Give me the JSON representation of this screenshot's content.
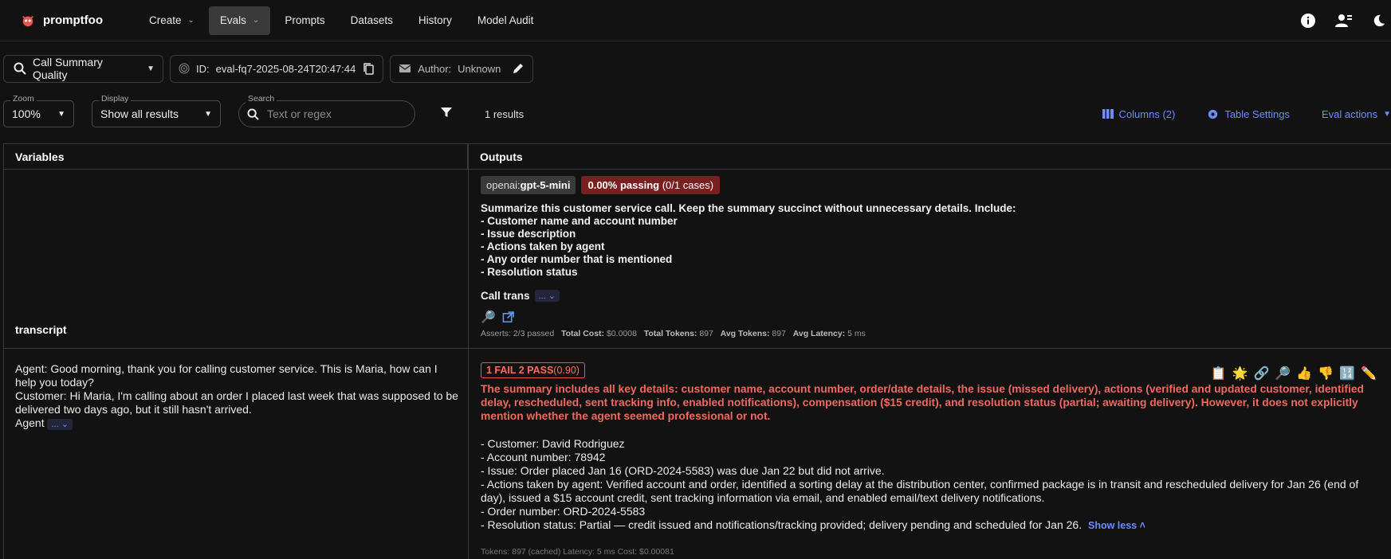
{
  "app": {
    "name": "promptfoo"
  },
  "nav": [
    {
      "label": "Create",
      "chevron": true,
      "active": false
    },
    {
      "label": "Evals",
      "chevron": true,
      "active": true
    },
    {
      "label": "Prompts",
      "chevron": false,
      "active": false
    },
    {
      "label": "Datasets",
      "chevron": false,
      "active": false
    },
    {
      "label": "History",
      "chevron": false,
      "active": false
    },
    {
      "label": "Model Audit",
      "chevron": false,
      "active": false
    }
  ],
  "eval_selector": {
    "value": "Call Summary Quality"
  },
  "eval_id": {
    "label": "ID:",
    "value": "eval-fq7-2025-08-24T20:47:44"
  },
  "author": {
    "label": "Author:",
    "value": "Unknown"
  },
  "controls": {
    "zoom_label": "Zoom",
    "zoom_value": "100%",
    "display_label": "Display",
    "display_value": "Show all results",
    "search_label": "Search",
    "search_placeholder": "Text or regex",
    "results": "1 results",
    "columns": "Columns (2)",
    "table_settings": "Table Settings",
    "eval_actions": "Eval actions"
  },
  "table": {
    "col_variables": "Variables",
    "col_outputs": "Outputs",
    "var_name": "transcript",
    "provider_prefix": "openai:",
    "provider_model": "gpt-5-mini",
    "pass_rate": "0.00% passing",
    "pass_cases": "(0/1 cases)",
    "prompt_text": "Summarize this customer service call. Keep the summary succinct without unnecessary details. Include:\n- Customer name and account number\n- Issue description\n- Actions taken by agent\n- Any order number that is mentioned\n- Resolution status",
    "call_trans": "Call trans",
    "more": "...",
    "stats": {
      "asserts": "Asserts: 2/3 passed",
      "cost_label": "Total Cost:",
      "cost": "$0.0008",
      "tokens_label": "Total Tokens:",
      "tokens": "897",
      "avg_tokens_label": "Avg Tokens:",
      "avg_tokens": "897",
      "avg_latency_label": "Avg Latency:",
      "avg_latency": "5 ms"
    },
    "transcript_text": "Agent: Good morning, thank you for calling customer service. This is Maria, how can I help you today?\nCustomer: Hi Maria, I'm calling about an order I placed last week that was supposed to be delivered two days ago, but it still hasn't arrived.\nAgent",
    "result_badge": "1 FAIL 2 PASS",
    "result_score": "(0.90)",
    "fail_reason": "The summary includes all key details: customer name, account number, order/date details, the issue (missed delivery), actions (verified and updated customer, identified delay, rescheduled, sent tracking info, enabled notifications), compensation ($15 credit), and resolution status (partial; awaiting delivery). However, it does not explicitly mention whether the agent seemed professional or not.",
    "answer": "- Customer: David Rodriguez\n- Account number: 78942\n- Issue: Order placed Jan 16 (ORD-2024-5583) was due Jan 22 but did not arrive.\n- Actions taken by agent: Verified account and order, identified a sorting delay at the distribution center, confirmed package is in transit and rescheduled delivery for Jan 26 (end of day), issued a $15 account credit, sent tracking information via email, and enabled email/text delivery notifications.\n- Order number: ORD-2024-5583\n- Resolution status: Partial — credit issued and notifications/tracking provided; delivery pending and scheduled for Jan 26.",
    "show_less": "Show less",
    "footer_faded": "Tokens: 897 (cached)   Latency: 5 ms   Cost: $0.00081"
  },
  "colors": {
    "accent": "#6c8cff",
    "fail": "#f0685e",
    "pass_bg": "#7a1f1f"
  }
}
